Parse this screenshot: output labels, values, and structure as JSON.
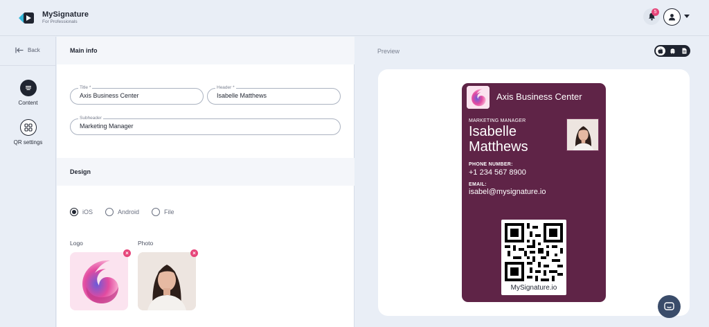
{
  "app": {
    "name": "MySignature",
    "tagline": "For Professionals",
    "notification_count": "5"
  },
  "rail": {
    "back_label": "Back",
    "items": [
      {
        "label": "Content",
        "icon": "list-icon",
        "active": true
      },
      {
        "label": "QR settings",
        "icon": "qr-icon",
        "active": false
      }
    ]
  },
  "editor": {
    "main_info_heading": "Main info",
    "fields": {
      "title": {
        "label": "Title *",
        "value": "Axis Business Center"
      },
      "header": {
        "label": "Header *",
        "value": "Isabelle Matthews"
      },
      "subheader": {
        "label": "Subheader",
        "value": "Marketing Manager"
      }
    },
    "design_heading": "Design",
    "platform_options": [
      {
        "label": "iOS",
        "selected": true
      },
      {
        "label": "Android",
        "selected": false
      },
      {
        "label": "File",
        "selected": false
      }
    ],
    "logo_label": "Logo",
    "photo_label": "Photo"
  },
  "preview": {
    "heading": "Preview",
    "pass": {
      "company": "Axis Business Center",
      "subheader": "MARKETING MANAGER",
      "name_line1": "Isabelle",
      "name_line2": "Matthews",
      "phone_label": "PHONE NUMBER:",
      "phone_value": "+1 234 567 8900",
      "email_label": "EMAIL:",
      "email_value": "isabel@mysignature.io",
      "qr_caption": "MySignature.io",
      "background_color": "#5f2447"
    }
  },
  "colors": {
    "accent_pink": "#e6457a",
    "dark": "#1f2430",
    "pass_purple": "#5f2447"
  }
}
